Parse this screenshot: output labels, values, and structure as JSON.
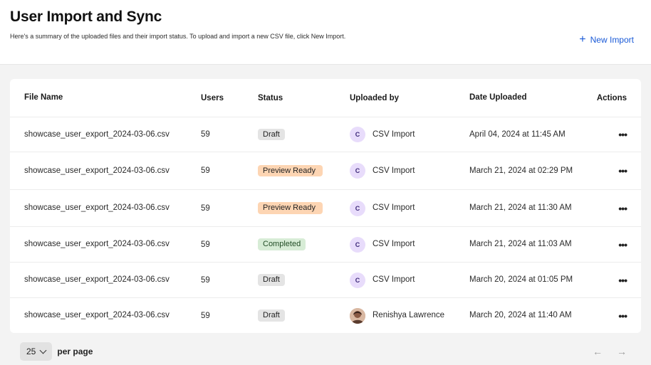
{
  "header": {
    "title": "User Import and Sync",
    "description": "Here's a summary of the uploaded files and their import status. To upload and import a new CSV file, click New Import.",
    "new_import_label": "New Import"
  },
  "table": {
    "columns": [
      "File Name",
      "Users",
      "Status",
      "Uploaded by",
      "Date Uploaded",
      "Actions"
    ],
    "rows": [
      {
        "file": "showcase_user_export_2024-03-06.csv",
        "users": "59",
        "status": "Draft",
        "uploader_initial": "C",
        "uploader": "CSV Import",
        "date": "April 04, 2024 at 11:45 AM",
        "actions": "•••"
      },
      {
        "file": "showcase_user_export_2024-03-06.csv",
        "users": "59",
        "status": "Preview Ready",
        "uploader_initial": "C",
        "uploader": "CSV Import",
        "date": "March 21, 2024 at 02:29 PM",
        "actions": "•••"
      },
      {
        "file": "showcase_user_export_2024-03-06.csv",
        "users": "59",
        "status": "Preview Ready",
        "uploader_initial": "C",
        "uploader": "CSV Import",
        "date": "March 21, 2024 at 11:30 AM",
        "actions": "•••"
      },
      {
        "file": "showcase_user_export_2024-03-06.csv",
        "users": "59",
        "status": "Completed",
        "uploader_initial": "C",
        "uploader": "CSV Import",
        "date": "March 21, 2024 at 11:03 AM",
        "actions": "•••"
      },
      {
        "file": "showcase_user_export_2024-03-06.csv",
        "users": "59",
        "status": "Draft",
        "uploader_initial": "C",
        "uploader": "CSV Import",
        "date": "March 20, 2024 at 01:05 PM",
        "actions": "•••"
      },
      {
        "file": "showcase_user_export_2024-03-06.csv",
        "users": "59",
        "status": "Draft",
        "uploader_initial": "",
        "uploader": "Renishya Lawrence",
        "date": "March 20, 2024 at 11:40 AM",
        "actions": "•••"
      }
    ]
  },
  "pagination": {
    "per_page_value": "25",
    "per_page_label": "per page",
    "prev_icon": "←",
    "next_icon": "→"
  },
  "colors": {
    "accent": "#1a5ad7",
    "draft": "#e4e4e4",
    "preview_ready": "#fdd5b3",
    "completed": "#d7ecd6",
    "avatar_bg": "#e8dcfb"
  }
}
